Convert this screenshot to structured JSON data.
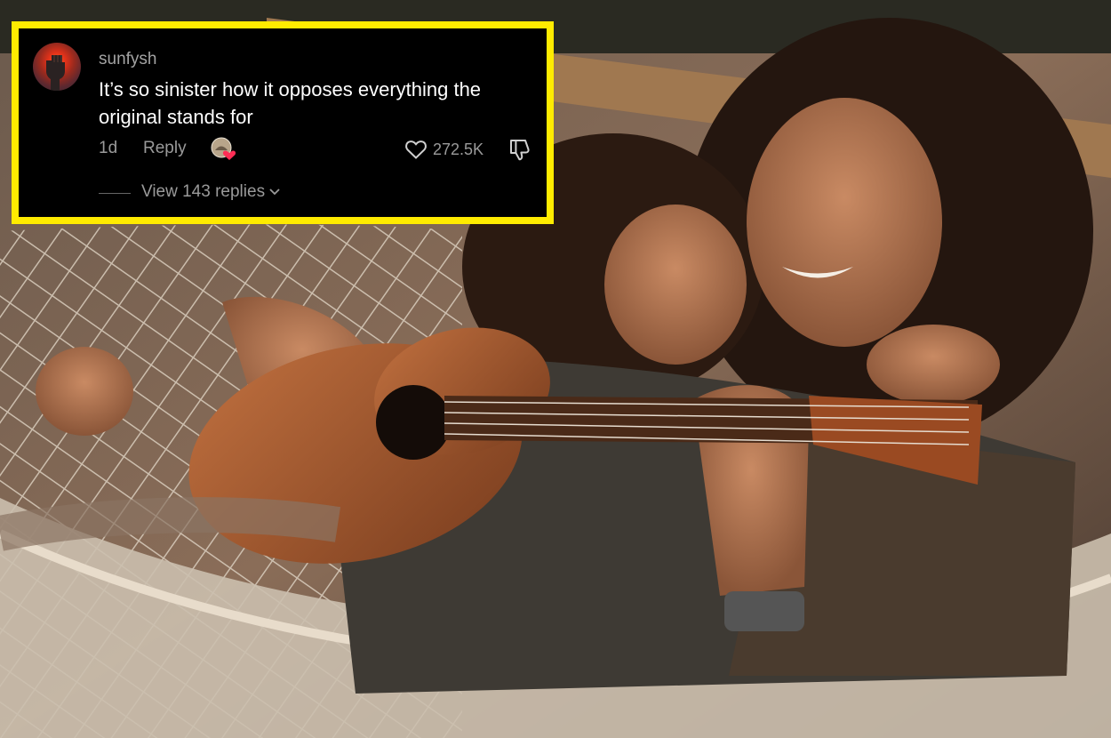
{
  "comment": {
    "username": "sunfysh",
    "text": "It’s so sinister how it opposes everything the original stands for",
    "time_ago": "1d",
    "reply_label": "Reply",
    "like_count": "272.5K",
    "view_replies_label": "View 143 replies"
  },
  "icons": {
    "avatar": "raised-fist-sunset-avatar",
    "creator_badge": "creator-liked-heart-badge",
    "like": "heart-outline-icon",
    "dislike": "thumbs-down-outline-icon",
    "expand": "chevron-down-icon"
  },
  "colors": {
    "highlight_border": "#ffeb00",
    "card_background": "#000000",
    "text_primary": "#ffffff",
    "text_secondary": "#9a9a9a",
    "badge_heart": "#ff2d55"
  }
}
